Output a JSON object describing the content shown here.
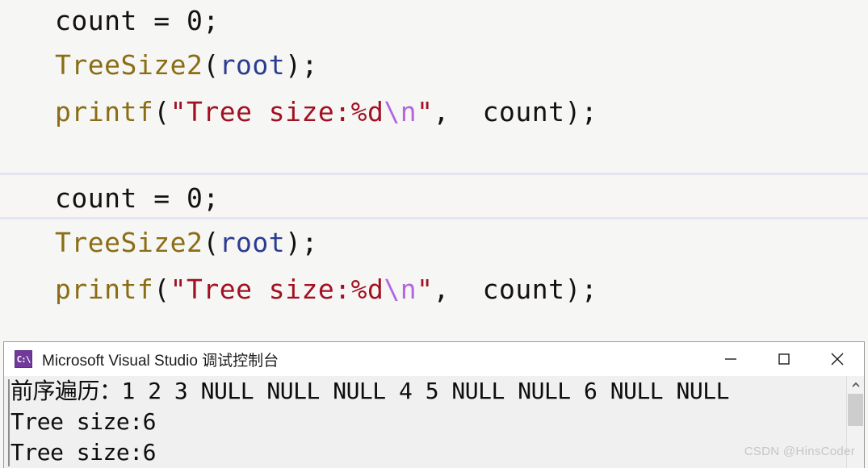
{
  "code": {
    "blocks": [
      {
        "id": "block-1",
        "lines": [
          {
            "id": "line-1-1",
            "highlighted": false,
            "text": "count = 0;",
            "tokens": [
              {
                "text": "count = 0;",
                "type": "plain"
              }
            ]
          },
          {
            "id": "line-1-2",
            "highlighted": false,
            "text": "TreeSize2(root);",
            "tokens": [
              {
                "text": "TreeSize2",
                "type": "func"
              },
              {
                "text": "(",
                "type": "punct"
              },
              {
                "text": "root",
                "type": "var"
              },
              {
                "text": ");",
                "type": "punct"
              }
            ]
          },
          {
            "id": "line-1-3",
            "highlighted": false,
            "text": "printf(\"Tree size:%d\\n\", count);",
            "tokens": [
              {
                "text": "printf",
                "type": "func"
              },
              {
                "text": "(",
                "type": "punct"
              },
              {
                "text": "\"Tree size:%d",
                "type": "str"
              },
              {
                "text": "\\n",
                "type": "esc"
              },
              {
                "text": "\"",
                "type": "str"
              },
              {
                "text": ",  count);",
                "type": "plain"
              }
            ]
          }
        ]
      },
      {
        "id": "block-2",
        "lines": [
          {
            "id": "line-2-1",
            "highlighted": true,
            "text": "count = 0;",
            "tokens": [
              {
                "text": "count = 0;",
                "type": "plain"
              }
            ]
          },
          {
            "id": "line-2-2",
            "highlighted": false,
            "text": "TreeSize2(root);",
            "tokens": [
              {
                "text": "TreeSize2",
                "type": "func"
              },
              {
                "text": "(",
                "type": "punct"
              },
              {
                "text": "root",
                "type": "var"
              },
              {
                "text": ");",
                "type": "punct"
              }
            ]
          },
          {
            "id": "line-2-3",
            "highlighted": false,
            "text": "printf(\"Tree size:%d\\n\", count);",
            "tokens": [
              {
                "text": "printf",
                "type": "func"
              },
              {
                "text": "(",
                "type": "punct"
              },
              {
                "text": "\"Tree size:%d",
                "type": "str"
              },
              {
                "text": "\\n",
                "type": "esc"
              },
              {
                "text": "\"",
                "type": "str"
              },
              {
                "text": ",  count);",
                "type": "plain"
              }
            ]
          }
        ]
      }
    ],
    "colors": {
      "plain": "#14110f",
      "func": "#8a6d14",
      "var": "#2b3c8e",
      "str": "#a11122",
      "esc": "#b466e0",
      "background": "#f6f6f4",
      "highlight_border": "#e4e4f2"
    }
  },
  "console": {
    "icon_label": "C:\\",
    "title": "Microsoft Visual Studio 调试控制台",
    "window_controls": [
      {
        "name": "minimize",
        "glyph": "—"
      },
      {
        "name": "maximize",
        "glyph": "□"
      },
      {
        "name": "close",
        "glyph": "✕"
      }
    ],
    "output_lines": [
      "前序遍历：1 2 3 NULL NULL NULL 4 5 NULL NULL 6 NULL NULL",
      "Tree size:6",
      "Tree size:6"
    ],
    "colors": {
      "titlebar_background": "#ffffff",
      "body_background": "#f0f0f0",
      "text": "#0d0d0d",
      "icon_background": "#70399b",
      "border": "#9c9c9c"
    }
  },
  "watermark": {
    "text": "CSDN @HinsCoder"
  }
}
